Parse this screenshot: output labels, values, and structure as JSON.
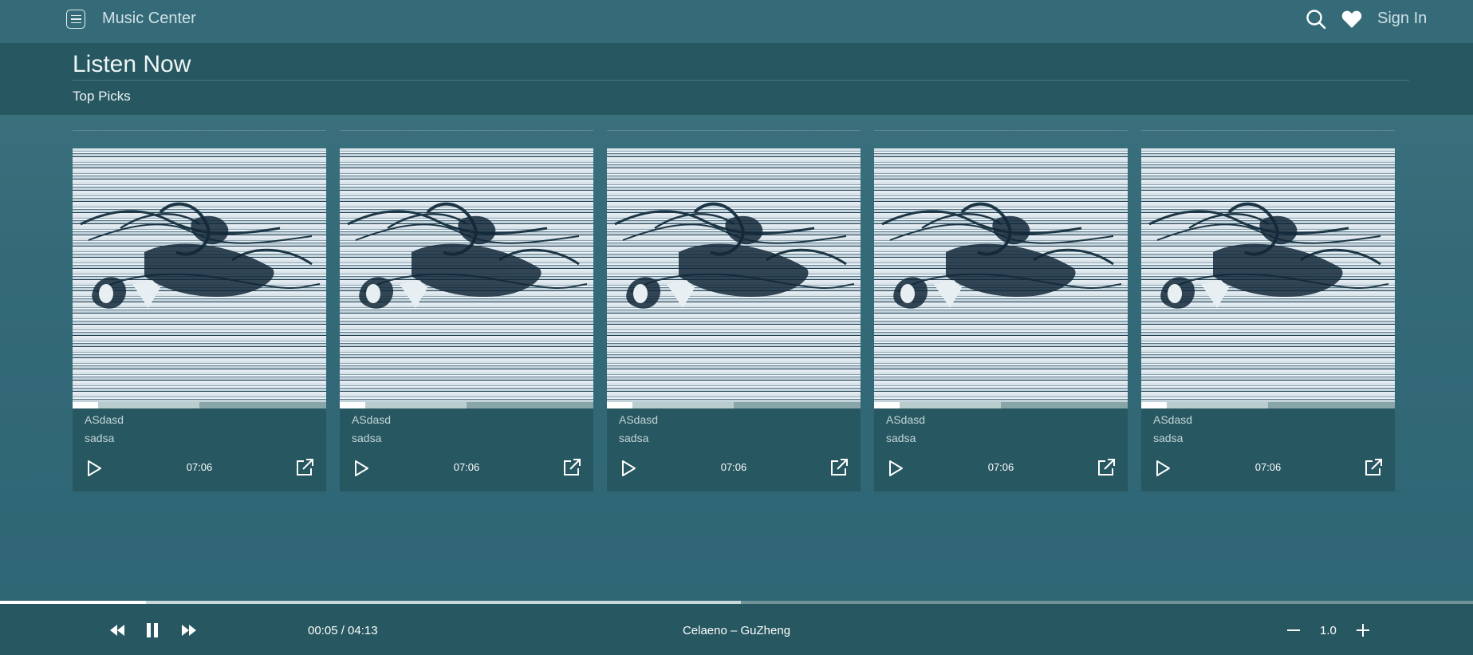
{
  "app": {
    "title": "Music Center",
    "sign_in_label": "Sign In"
  },
  "icons": {
    "menu": "menu-icon",
    "search": "search-icon",
    "favorites": "heart-icon",
    "play": "play-icon",
    "open": "external-link-icon",
    "prev": "rewind-icon",
    "pause": "pause-icon",
    "next": "fast-forward-icon",
    "minus": "minus-icon",
    "plus": "plus-icon"
  },
  "header": {
    "page_title": "Listen Now",
    "section_title": "Top Picks"
  },
  "cards": [
    {
      "title": "ASdasd",
      "subtitle": "sadsa",
      "duration": "07:06",
      "progress": 0.1,
      "buffered": 0.5
    },
    {
      "title": "ASdasd",
      "subtitle": "sadsa",
      "duration": "07:06",
      "progress": 0.1,
      "buffered": 0.5
    },
    {
      "title": "ASdasd",
      "subtitle": "sadsa",
      "duration": "07:06",
      "progress": 0.1,
      "buffered": 0.5
    },
    {
      "title": "ASdasd",
      "subtitle": "sadsa",
      "duration": "07:06",
      "progress": 0.1,
      "buffered": 0.5
    },
    {
      "title": "ASdasd",
      "subtitle": "sadsa",
      "duration": "07:06",
      "progress": 0.1,
      "buffered": 0.5
    }
  ],
  "player": {
    "time": "00:05 / 04:13",
    "track": "Celaeno – GuZheng",
    "speed": "1.0",
    "progress": 0.099,
    "buffered": 0.503
  },
  "colors": {
    "background": "#346a78",
    "topbar": "#356b79",
    "band": "#275760",
    "accent": "#ffffff"
  }
}
